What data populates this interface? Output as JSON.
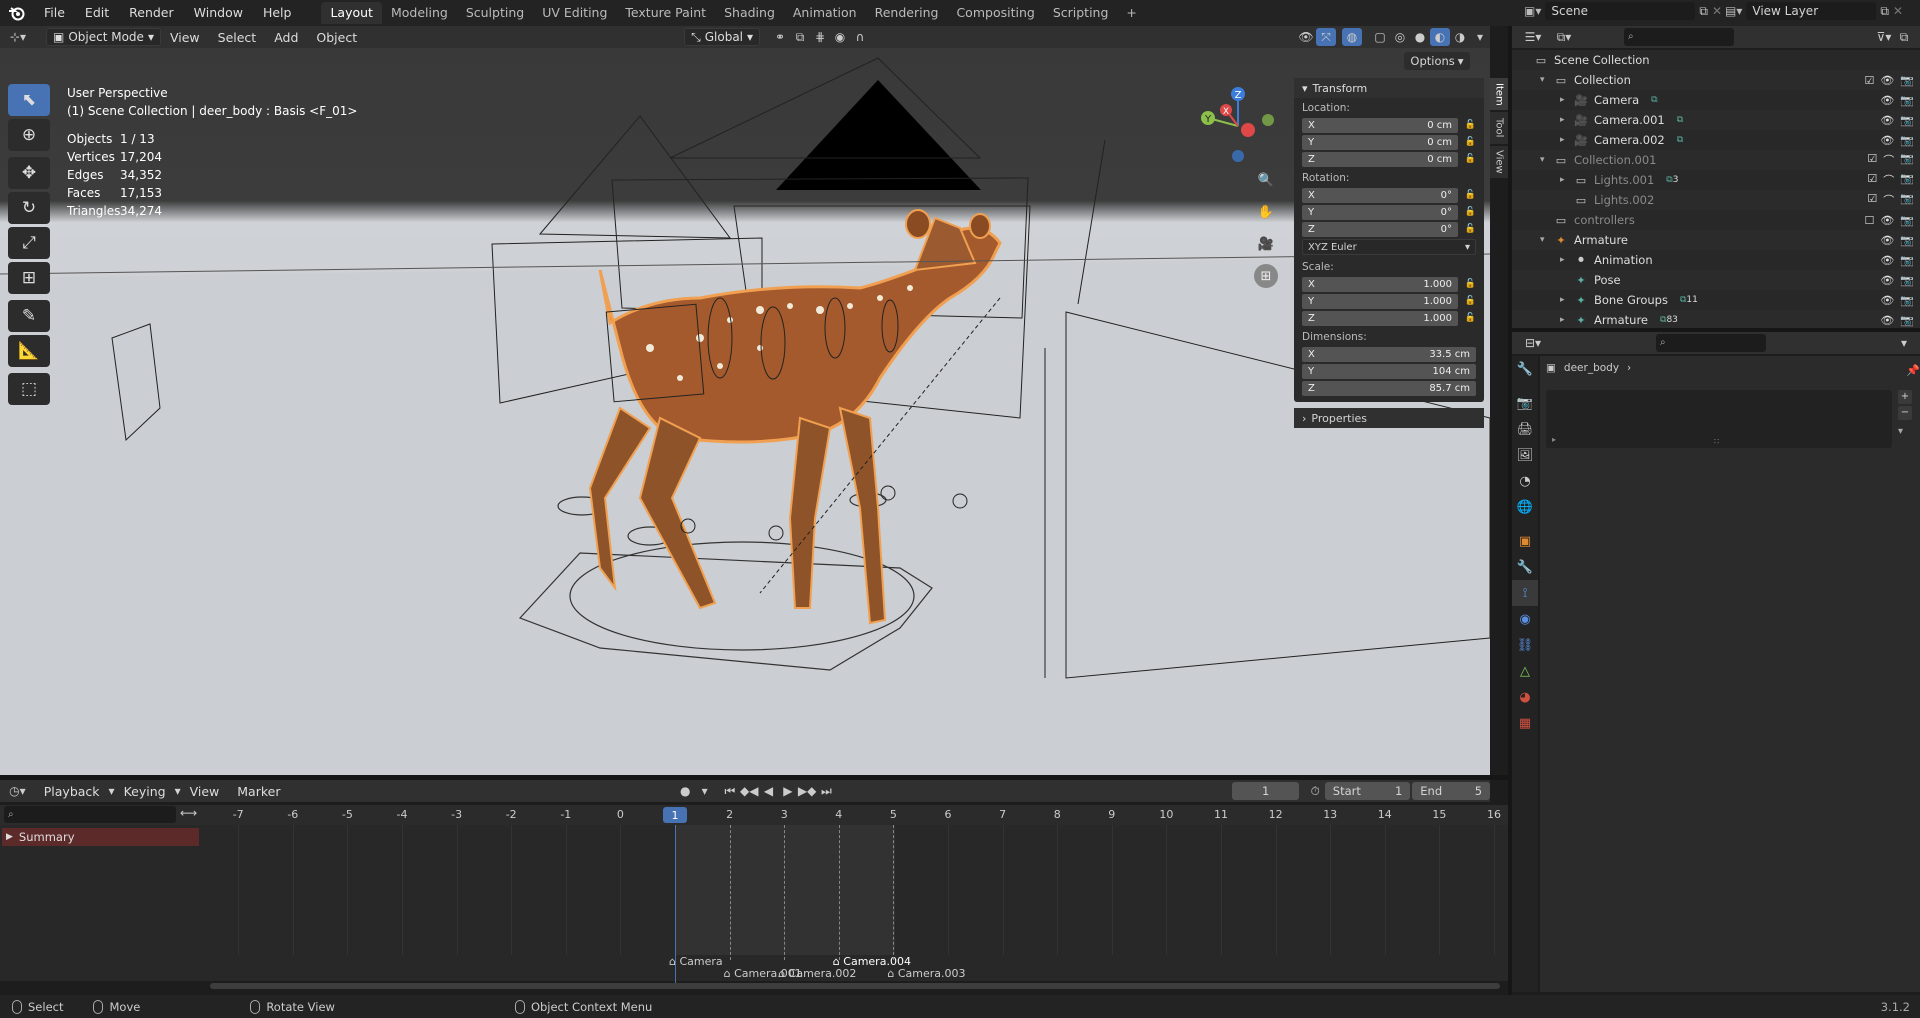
{
  "app": {
    "version": "3.1.2"
  },
  "topbar": {
    "menus": [
      "File",
      "Edit",
      "Render",
      "Window",
      "Help"
    ],
    "workspaces": [
      "Layout",
      "Modeling",
      "Sculpting",
      "UV Editing",
      "Texture Paint",
      "Shading",
      "Animation",
      "Rendering",
      "Compositing",
      "Scripting"
    ],
    "active_workspace": "Layout",
    "add_workspace": "+",
    "scene": "Scene",
    "view_layer": "View Layer"
  },
  "viewport_header": {
    "mode": "Object Mode",
    "menus": [
      "View",
      "Select",
      "Add",
      "Object"
    ],
    "orientation": "Global",
    "options": "Options"
  },
  "viewport": {
    "perspective": "User Perspective",
    "context": "(1) Scene Collection | deer_body : Basis <F_01>",
    "stats": [
      {
        "key": "Objects",
        "value": "1 / 13"
      },
      {
        "key": "Vertices",
        "value": "17,204"
      },
      {
        "key": "Edges",
        "value": "34,352"
      },
      {
        "key": "Faces",
        "value": "17,153"
      },
      {
        "key": "Triangles",
        "value": "34,274"
      }
    ],
    "gizmo_axes": [
      "X",
      "Y",
      "Z"
    ],
    "side_tabs": [
      "Item",
      "Tool",
      "View"
    ]
  },
  "transform_panel": {
    "title": "Transform",
    "location_label": "Location:",
    "location": [
      {
        "axis": "X",
        "value": "0 cm"
      },
      {
        "axis": "Y",
        "value": "0 cm"
      },
      {
        "axis": "Z",
        "value": "0 cm"
      }
    ],
    "rotation_label": "Rotation:",
    "rotation": [
      {
        "axis": "X",
        "value": "0°"
      },
      {
        "axis": "Y",
        "value": "0°"
      },
      {
        "axis": "Z",
        "value": "0°"
      }
    ],
    "rotation_mode": "XYZ Euler",
    "scale_label": "Scale:",
    "scale": [
      {
        "axis": "X",
        "value": "1.000"
      },
      {
        "axis": "Y",
        "value": "1.000"
      },
      {
        "axis": "Z",
        "value": "1.000"
      }
    ],
    "dimensions_label": "Dimensions:",
    "dimensions": [
      {
        "axis": "X",
        "value": "33.5 cm"
      },
      {
        "axis": "Y",
        "value": "104 cm"
      },
      {
        "axis": "Z",
        "value": "85.7 cm"
      }
    ],
    "properties_label": "Properties"
  },
  "timeline": {
    "menus": [
      "Playback",
      "Keying",
      "View",
      "Marker"
    ],
    "current_frame": "1",
    "start_label": "Start",
    "start": "1",
    "end_label": "End",
    "end": "5",
    "summary": "Summary",
    "ticks": [
      "-7",
      "-6",
      "-5",
      "-4",
      "-3",
      "-2",
      "-1",
      "0",
      "1",
      "2",
      "3",
      "4",
      "5",
      "6",
      "7",
      "8",
      "9",
      "10",
      "11",
      "12",
      "13",
      "14",
      "15",
      "16"
    ],
    "markers": [
      {
        "label": "Camera",
        "frame": 1,
        "row": 0
      },
      {
        "label": "Camera.001",
        "frame": 2,
        "row": 1
      },
      {
        "label": "Camera.002",
        "frame": 3,
        "row": 1
      },
      {
        "label": "Camera.004",
        "frame": 4,
        "row": 0,
        "selected": true
      },
      {
        "label": "Camera.003",
        "frame": 5,
        "row": 1
      }
    ]
  },
  "statusbar": {
    "items": [
      "Select",
      "Move",
      "Rotate View",
      "Object Context Menu"
    ]
  },
  "outliner": {
    "rows": [
      {
        "label": "Scene Collection",
        "depth": 0,
        "icon": "collection-icon",
        "arrow": ""
      },
      {
        "label": "Collection",
        "depth": 1,
        "icon": "collection-icon",
        "arrow": "▾",
        "check": true
      },
      {
        "label": "Camera",
        "depth": 2,
        "icon": "camera-icon",
        "arrow": "▸",
        "badge": ""
      },
      {
        "label": "Camera.001",
        "depth": 2,
        "icon": "camera-icon",
        "arrow": "▸",
        "badge": ""
      },
      {
        "label": "Camera.002",
        "depth": 2,
        "icon": "camera-icon",
        "arrow": "▸",
        "badge": ""
      },
      {
        "label": "Collection.001",
        "depth": 1,
        "icon": "collection-icon",
        "arrow": "▾",
        "dim": true,
        "check": true
      },
      {
        "label": "Lights.001",
        "depth": 2,
        "icon": "light-icon",
        "arrow": "▸",
        "dim": true,
        "badge": "3",
        "check": true
      },
      {
        "label": "Lights.002",
        "depth": 2,
        "icon": "light-icon",
        "arrow": "",
        "dim": true,
        "check": true
      },
      {
        "label": "controllers",
        "depth": 1,
        "icon": "collection-icon",
        "arrow": "",
        "dim": true
      },
      {
        "label": "Armature",
        "depth": 1,
        "icon": "armature-icon",
        "arrow": "▾"
      },
      {
        "label": "Animation",
        "depth": 2,
        "icon": "animation-icon",
        "arrow": "▸"
      },
      {
        "label": "Pose",
        "depth": 2,
        "icon": "pose-icon",
        "arrow": ""
      },
      {
        "label": "Bone Groups",
        "depth": 2,
        "icon": "bone-groups-icon",
        "arrow": "▸",
        "badge": "11"
      },
      {
        "label": "Armature",
        "depth": 2,
        "icon": "armature-data-icon",
        "arrow": "▸",
        "badge": "83"
      }
    ]
  },
  "properties": {
    "object_name": "deer_body",
    "tabs": [
      "tool-icon",
      "render-icon",
      "output-icon",
      "view-layer-icon",
      "scene-icon",
      "world-icon",
      "object-icon",
      "modifier-icon",
      "particles-icon",
      "physics-icon",
      "constraints-icon",
      "data-icon",
      "material-icon",
      "texture-icon"
    ]
  },
  "colors": {
    "accent": "#4772b3",
    "summary_bg": "#5d2a2a",
    "selection_outline": "#f0a050"
  }
}
